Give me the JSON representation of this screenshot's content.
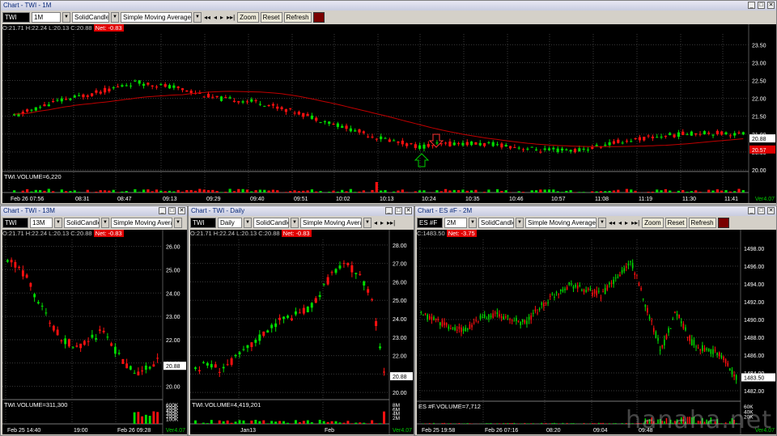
{
  "top": {
    "title": "Chart - TWI - 1M",
    "symbol": "TWI",
    "interval": "1M",
    "style": "SolidCandle",
    "study": "Simple Moving Average",
    "info": {
      "o": "O:21.71",
      "h": "H:22.24",
      "l": "L:20.13",
      "c": "C:20.88",
      "net": "Net: -0.83"
    },
    "volume_label": "TWI.VOLUME=6,220",
    "price_ticks": [
      "23.50",
      "23.00",
      "22.50",
      "22.00",
      "21.50",
      "21.00",
      "20.50",
      "20.00"
    ],
    "last_price": "20.88",
    "ma_price": "20.57",
    "time_ticks": [
      "Feb 26 07:56",
      "08:31",
      "08:47",
      "09:13",
      "09:29",
      "09:40",
      "09:51",
      "10:02",
      "10:13",
      "10:24",
      "10:35",
      "10:46",
      "10:57",
      "11:08",
      "11:19",
      "11:30",
      "11:41"
    ],
    "version": "Ver4.07"
  },
  "bl": {
    "title": "Chart - TWI - 13M",
    "symbol": "TWI",
    "interval": "13M",
    "style": "SolidCandle",
    "study": "Simple Moving Average",
    "info": {
      "o": "O:21.71",
      "h": "H:22.24",
      "l": "L:20.13",
      "c": "C:20.88",
      "net": "Net: -0.83"
    },
    "volume_label": "TWI.VOLUME=311,300",
    "price_ticks": [
      "26.00",
      "25.00",
      "24.00",
      "23.00",
      "22.00",
      "21.00",
      "20.00"
    ],
    "last_price": "20.88",
    "vol_ticks": [
      "600K",
      "500K",
      "400K",
      "300K",
      "200K",
      "100K"
    ],
    "time_ticks": [
      "Feb 25 14:40",
      "19:00",
      "Feb 26 09:28"
    ],
    "version": "Ver4.07"
  },
  "bm": {
    "title": "Chart - TWI - Daily",
    "symbol": "TWI",
    "interval": "Daily",
    "style": "SolidCandle",
    "study": "Simple Moving Average",
    "info": {
      "o": "O:21.71",
      "h": "H:22.24",
      "l": "L:20.13",
      "c": "C:20.88",
      "net": "Net: -0.83"
    },
    "volume_label": "TWI.VOLUME=4,419,201",
    "price_ticks": [
      "28.00",
      "27.00",
      "26.00",
      "25.00",
      "24.00",
      "23.00",
      "22.00",
      "21.00",
      "20.00"
    ],
    "last_price": "20.88",
    "vol_ticks": [
      "8M",
      "6M",
      "4M",
      "2M"
    ],
    "time_ticks": [
      "Jan13",
      "Feb"
    ],
    "version": "Ver4.07"
  },
  "br": {
    "title": "Chart - ES #F - 2M",
    "symbol": "ES #F",
    "interval": "2M",
    "style": "SolidCandle",
    "study": "Simple Moving Average",
    "info": {
      "c": "C:1483.50",
      "net": "Net: -3.75"
    },
    "volume_label": "ES #F.VOLUME=7,712",
    "price_ticks": [
      "1498.00",
      "1496.00",
      "1494.00",
      "1492.00",
      "1490.00",
      "1488.00",
      "1486.00",
      "1484.00",
      "1482.00"
    ],
    "last_price": "1483.50",
    "vol_ticks": [
      "60K",
      "40K",
      "20K"
    ],
    "time_ticks": [
      "Feb 25 19:58",
      "Feb 26 07:16",
      "08:20",
      "09:04",
      "09:48"
    ],
    "version": "Ver4.07"
  },
  "common": {
    "zoom": "Zoom",
    "reset": "Reset",
    "refresh": "Refresh",
    "nav_prev": "◂",
    "nav_next": "▸",
    "nav_first": "◂◂",
    "nav_last": "▸▸|",
    "minimize": "_",
    "maximize": "□",
    "close": "✕"
  },
  "watermark": "hanaha.net",
  "colors": {
    "up": "#00dd00",
    "down": "#ff1010",
    "ma": "#c00000",
    "grid": "#3a3a3a",
    "bg": "#000000",
    "price_tag": "#ffffff",
    "ma_tag": "#e00000"
  }
}
